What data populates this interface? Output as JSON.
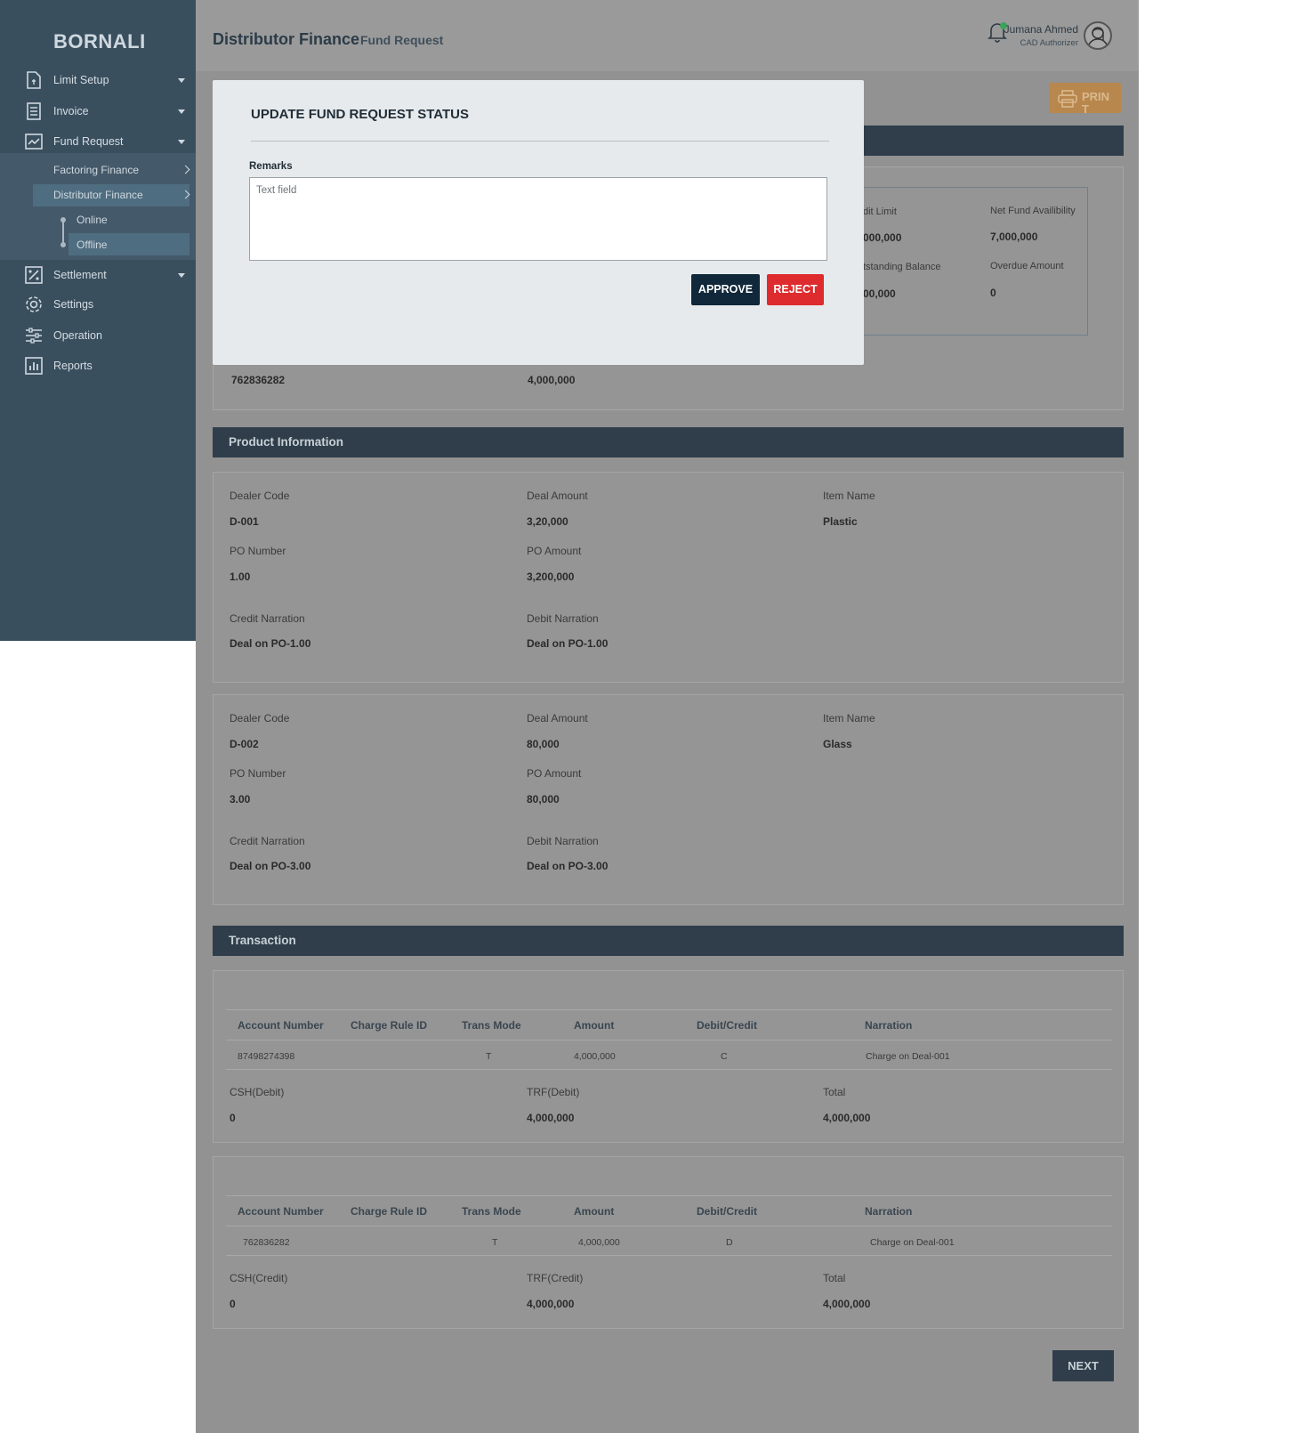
{
  "sidebar": {
    "brand": "BORNALI",
    "items": [
      {
        "label": "Limit Setup"
      },
      {
        "label": "Invoice"
      },
      {
        "label": "Fund Request"
      },
      {
        "label": "Settlement"
      },
      {
        "label": "Settings"
      },
      {
        "label": "Operation"
      },
      {
        "label": "Reports"
      }
    ],
    "fund_request_sub": [
      {
        "label": "Factoring Finance"
      },
      {
        "label": "Distributor Finance"
      }
    ],
    "distributor_sub": [
      {
        "label": "Online"
      },
      {
        "label": "Offline"
      }
    ]
  },
  "header": {
    "title": "Distributor Finance",
    "subtitle": "Fund Request",
    "user_name": "Jumana Ahmed",
    "user_role": "CAD Authorizer"
  },
  "toolbar": {
    "print_label": "PRINT"
  },
  "summary": {
    "credit_limit_label": "dit Limit",
    "credit_limit_value": "000,000",
    "net_fund_label": "Net Fund Availibility",
    "net_fund_value": "7,000,000",
    "outstanding_label": "tstanding Balance",
    "outstanding_value": "00,000",
    "overdue_label": "Overdue Amount",
    "overdue_value": "0",
    "account_value": "762836282",
    "amount_value": "4,000,000"
  },
  "product": {
    "title": "Product Information",
    "labels": {
      "dealer_code": "Dealer Code",
      "deal_amount": "Deal Amount",
      "item_name": "Item Name",
      "po_number": "PO Number",
      "po_amount": "PO Amount",
      "credit_narration": "Credit Narration",
      "debit_narration": "Debit Narration"
    },
    "items": [
      {
        "dealer_code": "D-001",
        "deal_amount": "3,20,000",
        "item_name": "Plastic",
        "po_number": "1.00",
        "po_amount": "3,200,000",
        "credit_narration": "Deal on PO-1.00",
        "debit_narration": "Deal on PO-1.00"
      },
      {
        "dealer_code": "D-002",
        "deal_amount": "80,000",
        "item_name": "Glass",
        "po_number": "3.00",
        "po_amount": "80,000",
        "credit_narration": "Deal on PO-3.00",
        "debit_narration": "Deal on PO-3.00"
      }
    ]
  },
  "transaction": {
    "title": "Transaction",
    "columns": [
      "Account Number",
      "Charge Rule ID",
      "Trans Mode",
      "Amount",
      "Debit/Credit",
      "Narration"
    ],
    "blocks": [
      {
        "row": {
          "account": "87498274398",
          "charge_rule": "",
          "mode": "T",
          "amount": "4,000,000",
          "dc": "C",
          "narration": "Charge on Deal-001"
        },
        "csh_label": "CSH(Debit)",
        "csh_value": "0",
        "trf_label": "TRF(Debit)",
        "trf_value": "4,000,000",
        "total_label": "Total",
        "total_value": "4,000,000"
      },
      {
        "row": {
          "account": "762836282",
          "charge_rule": "",
          "mode": "T",
          "amount": "4,000,000",
          "dc": "D",
          "narration": "Charge on Deal-001"
        },
        "csh_label": "CSH(Credit)",
        "csh_value": "0",
        "trf_label": "TRF(Credit)",
        "trf_value": "4,000,000",
        "total_label": "Total",
        "total_value": "4,000,000"
      }
    ]
  },
  "next_label": "NEXT",
  "modal": {
    "title": "UPDATE FUND REQUEST STATUS",
    "remarks_label": "Remarks",
    "remarks_placeholder": "Text field",
    "approve_label": "APPROVE",
    "reject_label": "REJECT"
  },
  "colors": {
    "sidebar": "#3a4f5e",
    "section_bar": "#2f3e4a",
    "approve": "#10283a",
    "reject": "#de2b2e",
    "print": "#b8874d"
  }
}
